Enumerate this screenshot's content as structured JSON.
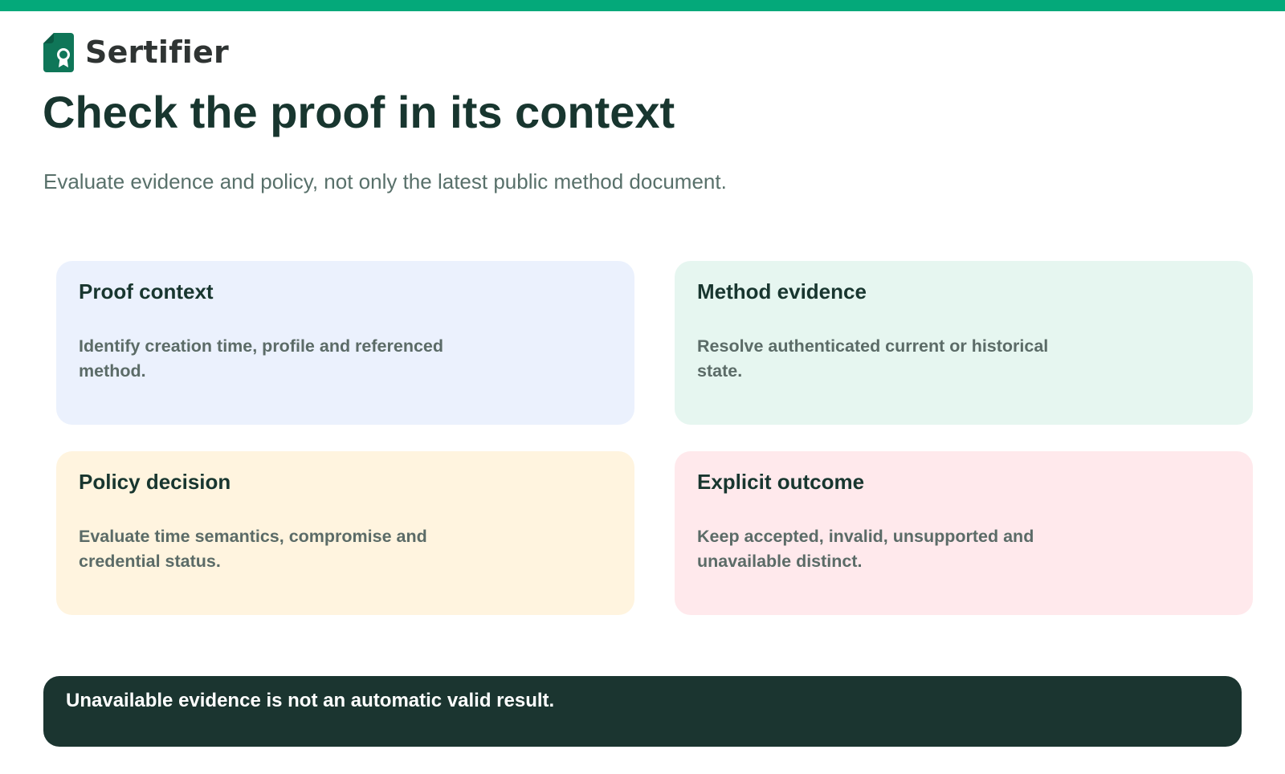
{
  "colors": {
    "accent": "#04a97a",
    "brand_dark": "#0f7658",
    "title": "#18362f",
    "subtitle": "#58706a",
    "card_blue": "#ebf1fd",
    "card_green": "#e6f6f0",
    "card_yellow": "#fff4df",
    "card_pink": "#ffe9ec",
    "callout_bg": "#1b3530"
  },
  "brand": {
    "icon": "certificate-badge-icon",
    "name": "Sertifier"
  },
  "header": {
    "title": "Check the proof in its context",
    "subtitle": "Evaluate evidence and policy, not only the latest public method document."
  },
  "cards": [
    {
      "title": "Proof context",
      "text": "Identify creation time, profile and referenced method."
    },
    {
      "title": "Method evidence",
      "text": "Resolve authenticated current or historical state."
    },
    {
      "title": "Policy decision",
      "text": "Evaluate time semantics, compromise and credential status."
    },
    {
      "title": "Explicit outcome",
      "text": "Keep accepted, invalid, unsupported and unavailable distinct."
    }
  ],
  "callout": {
    "text": "Unavailable evidence is not an automatic valid result."
  }
}
